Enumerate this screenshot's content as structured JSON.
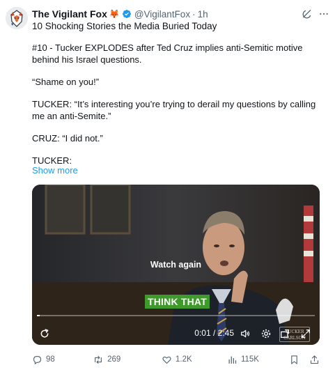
{
  "author": {
    "name": "The Vigilant Fox",
    "emoji": "🦊",
    "handle": "@VigilantFox",
    "separator": "·",
    "time": "1h",
    "subtitle": "10 Shocking Stories the Media Buried Today"
  },
  "body": {
    "paragraphs": [
      "#10 - Tucker EXPLODES after Ted Cruz implies anti-Semitic motive behind his Israel questions.",
      "“Shame on you!”",
      "TUCKER: “It’s interesting you’re trying to derail my questions by calling me an anti-Semite.”",
      "CRUZ: “I did not.”",
      "TUCKER:"
    ],
    "show_more": "Show more"
  },
  "video": {
    "overlay_text": "Watch again",
    "caption": "THINK THAT",
    "timecode": "0:01 / 2:45",
    "progress": 0.006,
    "icons": [
      "replay-icon",
      "volume-icon",
      "settings-icon",
      "picture-in-picture-icon",
      "fullscreen-icon"
    ],
    "watermark": "TUCKER CARLSON"
  },
  "actions": {
    "replies": "98",
    "reposts": "269",
    "likes": "1.2K",
    "views": "115K"
  },
  "colors": {
    "accent": "#1d9bf0",
    "muted": "#536471",
    "caption_bg": "#3d9a2b",
    "verified": "#1d9bf0"
  }
}
